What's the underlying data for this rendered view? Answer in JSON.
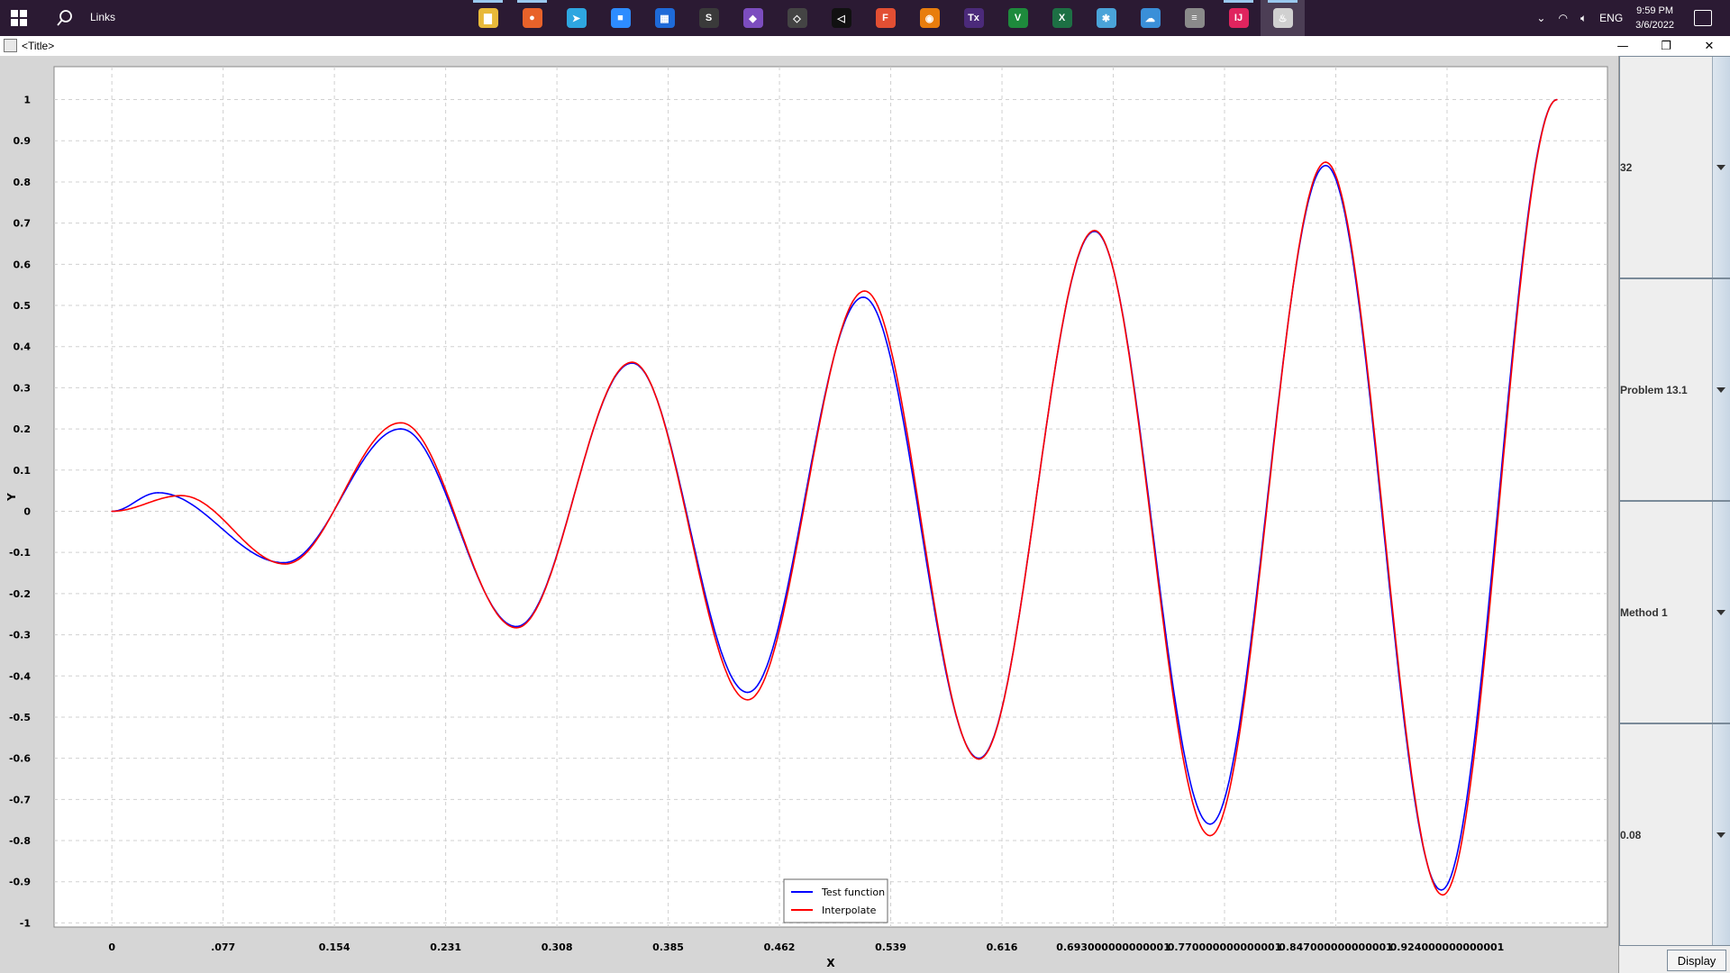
{
  "taskbar": {
    "search_label": "Links",
    "apps": [
      {
        "name": "file-explorer-icon",
        "color": "#e8b93a",
        "glyph": "▇",
        "running": true
      },
      {
        "name": "firefox-icon",
        "color": "#e8622a",
        "glyph": "●",
        "running": true
      },
      {
        "name": "telegram-icon",
        "color": "#2ea6e0",
        "glyph": "➤",
        "running": false
      },
      {
        "name": "zoom-icon",
        "color": "#2d8cff",
        "glyph": "■",
        "running": false
      },
      {
        "name": "calendar-app-icon",
        "color": "#1e6ad8",
        "glyph": "▦",
        "running": false
      },
      {
        "name": "sublime-text-icon",
        "color": "#3a3a3a",
        "glyph": "S",
        "running": false
      },
      {
        "name": "visual-studio-icon",
        "color": "#7c4dbf",
        "glyph": "◆",
        "running": false
      },
      {
        "name": "unity-icon",
        "color": "#444444",
        "glyph": "◇",
        "running": false
      },
      {
        "name": "unity-hub-icon",
        "color": "#111111",
        "glyph": "◁",
        "running": false
      },
      {
        "name": "figma-icon",
        "color": "#e24f33",
        "glyph": "F",
        "running": false
      },
      {
        "name": "blender-icon",
        "color": "#e87d0d",
        "glyph": "◉",
        "running": false
      },
      {
        "name": "texstudio-icon",
        "color": "#4b2a7a",
        "glyph": "Tx",
        "running": false
      },
      {
        "name": "vs-green-icon",
        "color": "#1e8a3c",
        "glyph": "V",
        "running": false
      },
      {
        "name": "excel-icon",
        "color": "#1d7044",
        "glyph": "X",
        "running": false
      },
      {
        "name": "snowflake-app-icon",
        "color": "#4aa3d8",
        "glyph": "✱",
        "running": false
      },
      {
        "name": "cloud-gear-icon",
        "color": "#3a8fd8",
        "glyph": "☁",
        "running": false
      },
      {
        "name": "database-icon",
        "color": "#8a8a8a",
        "glyph": "≡",
        "running": false
      },
      {
        "name": "intellij-icon",
        "color": "#e0245e",
        "glyph": "IJ",
        "running": true
      },
      {
        "name": "java-app-icon",
        "color": "#d0d0d0",
        "glyph": "♨",
        "running": true,
        "active": true
      }
    ],
    "language": "ENG",
    "time": "9:59 PM",
    "date": "3/6/2022"
  },
  "window": {
    "title": "<Title>",
    "minimize": "—",
    "restore": "❐",
    "close": "✕"
  },
  "controls": {
    "combo1": "32",
    "combo2": "Problem 13.1",
    "combo3": "Method 1",
    "combo4": "0.08",
    "display_label": "Display"
  },
  "chart_data": {
    "type": "line",
    "title": "",
    "xlabel": "X",
    "ylabel": "Y",
    "xlim": [
      -0.04,
      1.035
    ],
    "ylim": [
      -1.01,
      1.08
    ],
    "xticks": [
      0,
      0.077,
      0.154,
      0.231,
      0.308,
      0.385,
      0.462,
      0.539,
      0.616,
      0.693,
      0.77,
      0.847,
      0.924
    ],
    "xtick_labels": [
      "0",
      ".077",
      "0.154",
      "0.231",
      "0.308",
      "0.385",
      "0.462",
      "0.539",
      "0.616",
      "0.693000000000001",
      "0.770000000000001",
      "0.847000000000001",
      "0.924000000000001"
    ],
    "yticks": [
      -1,
      -0.9,
      -0.8,
      -0.7,
      -0.6,
      -0.5,
      -0.4,
      -0.3,
      -0.2,
      -0.1,
      0,
      0.1,
      0.2,
      0.3,
      0.4,
      0.5,
      0.6,
      0.7,
      0.8,
      0.9,
      1
    ],
    "ytick_labels": [
      "-1",
      "-0.9",
      "-0.8",
      "-0.7",
      "-0.6",
      "-0.5",
      "-0.4",
      "-0.3",
      "-0.2",
      "-0.1",
      "0",
      "0.1",
      "0.2",
      "0.3",
      "0.4",
      "0.5",
      "0.6",
      "0.7",
      "0.8",
      "0.9",
      "1"
    ],
    "grid": true,
    "legend": "bottom-center",
    "series": [
      {
        "name": "Test function",
        "color": "#0000ff",
        "x": [
          0,
          0.032,
          0.119,
          0.2,
          0.28,
          0.36,
          0.44,
          0.52,
          0.6,
          0.68,
          0.76,
          0.84,
          0.92,
          1.0
        ],
        "y": [
          0,
          0.045,
          -0.125,
          0.2,
          -0.28,
          0.36,
          -0.44,
          0.52,
          -0.6,
          0.68,
          -0.76,
          0.84,
          -0.92,
          1.0
        ]
      },
      {
        "name": "Interpolate",
        "color": "#ff0000",
        "x": [
          0,
          0.048,
          0.12,
          0.2,
          0.28,
          0.36,
          0.44,
          0.521,
          0.6,
          0.68,
          0.76,
          0.84,
          0.921,
          1.0
        ],
        "y": [
          0,
          0.038,
          -0.128,
          0.215,
          -0.283,
          0.362,
          -0.458,
          0.535,
          -0.602,
          0.682,
          -0.788,
          0.848,
          -0.932,
          1.0
        ]
      }
    ]
  }
}
